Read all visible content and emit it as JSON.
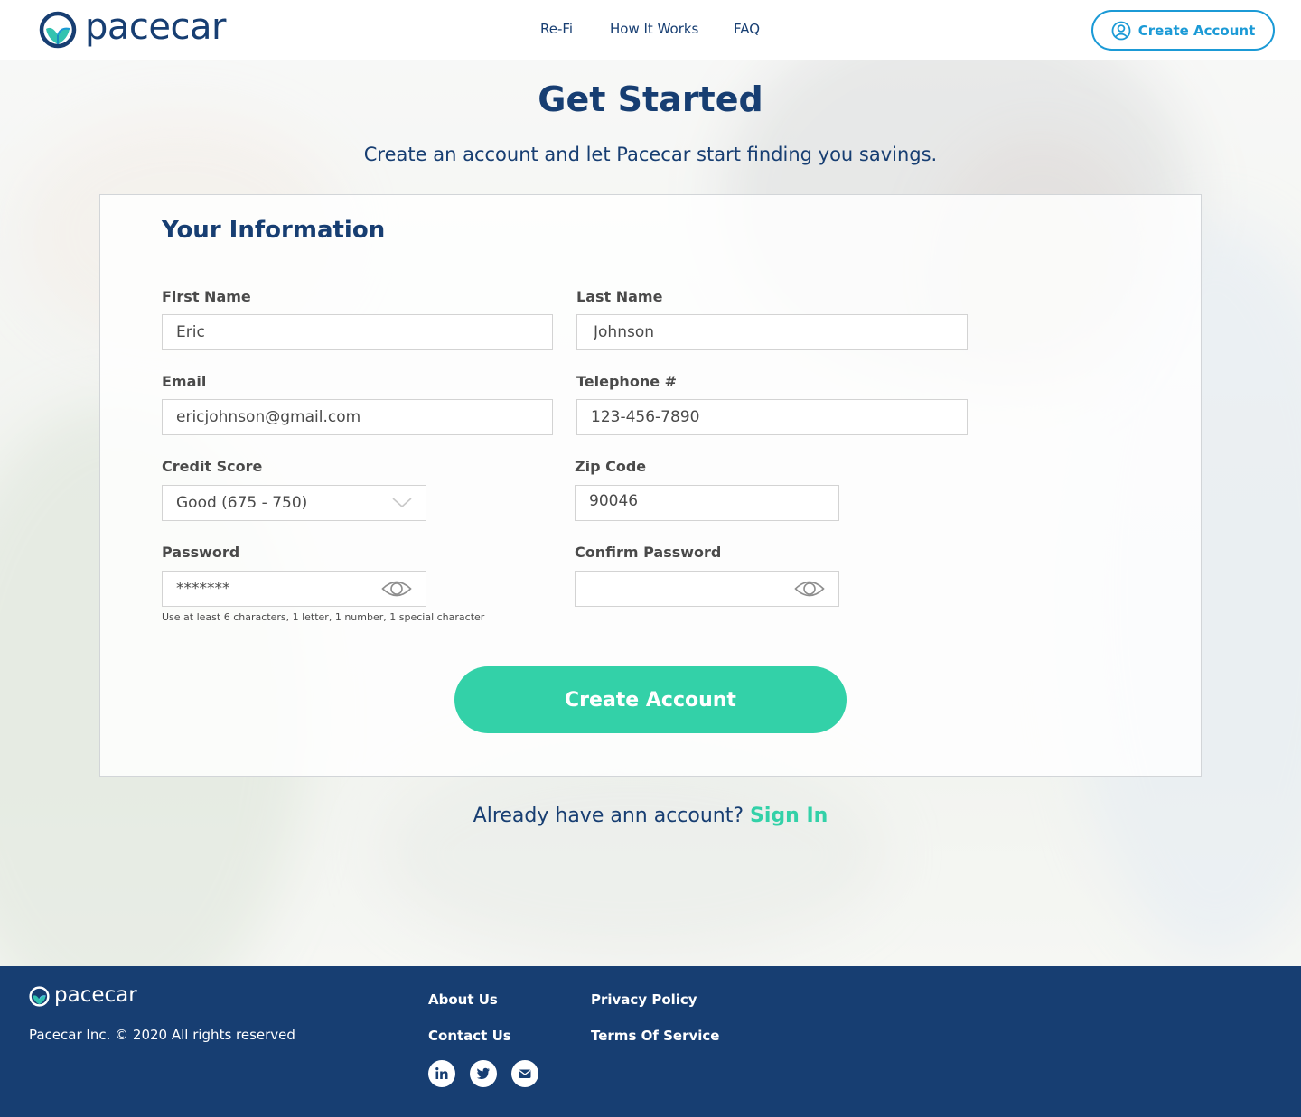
{
  "header": {
    "brand": "pacecar",
    "nav": [
      {
        "label": "Re-Fi"
      },
      {
        "label": "How It Works"
      },
      {
        "label": "FAQ"
      }
    ],
    "create_account_label": "Create Account"
  },
  "hero": {
    "title": "Get Started",
    "subtitle": "Create an account and let Pacecar start finding you savings."
  },
  "form": {
    "heading": "Your Information",
    "first_name": {
      "label": "First Name",
      "value": "Eric"
    },
    "last_name": {
      "label": "Last Name",
      "value": "Johnson"
    },
    "email": {
      "label": "Email",
      "value": "ericjohnson@gmail.com"
    },
    "telephone": {
      "label": "Telephone #",
      "value": "123-456-7890"
    },
    "credit_score": {
      "label": "Credit Score",
      "value": "Good (675 - 750)"
    },
    "zip_code": {
      "label": "Zip Code",
      "value": "90046"
    },
    "password": {
      "label": "Password",
      "value": "*******",
      "hint": "Use at least 6 characters, 1 letter, 1 number, 1 special character"
    },
    "confirm_password": {
      "label": "Confirm Password",
      "value": ""
    },
    "submit_label": "Create Account"
  },
  "signin": {
    "prompt": "Already have ann account?",
    "link": "Sign In"
  },
  "footer": {
    "brand": "pacecar",
    "copyright": "Pacecar Inc. © 2020 All rights reserved",
    "links": {
      "about": "About Us",
      "contact": "Contact Us",
      "privacy": "Privacy Policy",
      "terms": "Terms Of Service"
    },
    "social_icons": [
      "linkedin-icon",
      "twitter-icon",
      "mail-icon"
    ]
  },
  "colors": {
    "brand_navy": "#173e72",
    "accent_green": "#33d1a8",
    "accent_blue": "#1b9ad6"
  }
}
